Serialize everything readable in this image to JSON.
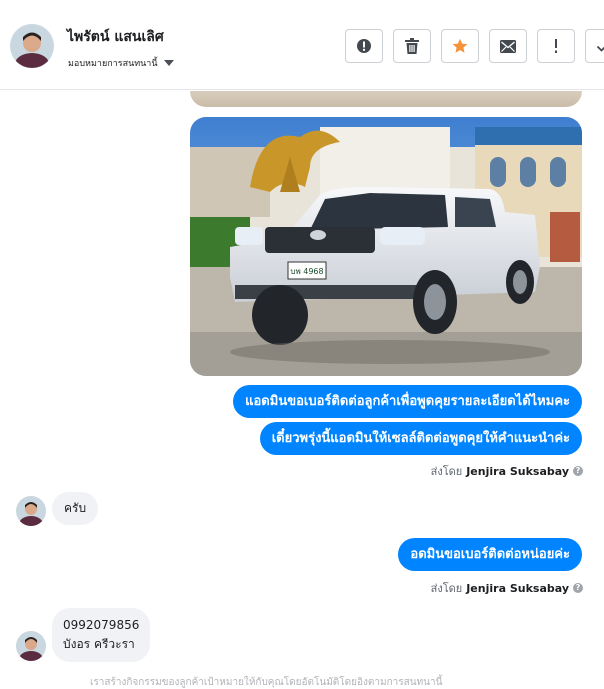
{
  "contact": {
    "name": "ไพรัตน์ แสนเลิศ",
    "assign_label": "มอบหมายการสนทนานี้"
  },
  "toolbar": {
    "buttons": [
      {
        "icon": "alert-circle-icon"
      },
      {
        "icon": "trash-icon"
      },
      {
        "icon": "star-icon"
      },
      {
        "icon": "mail-icon"
      },
      {
        "icon": "exclamation-icon"
      },
      {
        "icon": "checkmark-icon"
      }
    ],
    "accent": "#f7923a"
  },
  "messages": {
    "out_1": "แอดมินขอเบอร์ติดต่อลูกค้าเพื่อพูดคุยรายละเอียดได้ไหมคะ",
    "out_2": "เดี๋ยวพรุ่งนี้แอดมินให้เซลล์ติดต่อพูดคุยให้คำแนะนำค่ะ",
    "sent_by_prefix": "ส่งโดย",
    "sent_by_name": "Jenjira Suksabay",
    "in_1": "ครับ",
    "out_3": "อดมินขอเบอร์ติดต่อหน่อยค่ะ",
    "in_2_line1": "0992079856",
    "in_2_line2": "บังอร ครีวะรา",
    "footer_note": "เราสร้างกิจกรรมของลูกค้าเป้าหมายให้กับคุณโดยอัตโนมัติโดยอิงตามการสนทนานี้"
  },
  "photo": {
    "plate": "บพ 4968"
  },
  "colors": {
    "bubble_out": "#0084ff",
    "bubble_in": "#f0f2f5"
  }
}
